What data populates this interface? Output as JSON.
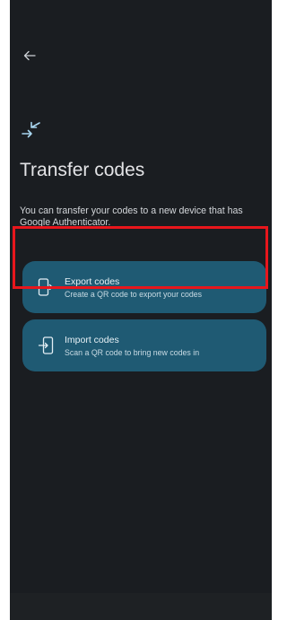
{
  "header": {
    "back_icon": "arrow-left-icon"
  },
  "hero": {
    "icon": "transfer-arrows-icon",
    "title": "Transfer codes",
    "description": "You can transfer your codes to a new device that has Google Authenticator."
  },
  "options": [
    {
      "icon": "phone-export-icon",
      "title": "Export codes",
      "subtitle": "Create a QR code to export your codes"
    },
    {
      "icon": "phone-import-icon",
      "title": "Import codes",
      "subtitle": "Scan a QR code to bring new codes in"
    }
  ],
  "highlight": {
    "target": "export-codes-card",
    "color": "#e8161c"
  },
  "colors": {
    "background": "#1a1d21",
    "card": "#1f5a73",
    "accent": "#a8d5ef",
    "text": "#e3e3e6"
  }
}
